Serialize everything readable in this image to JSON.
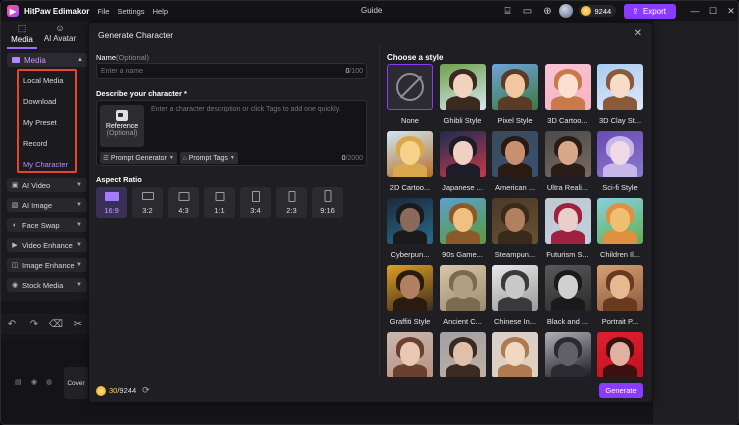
{
  "app": {
    "title": "HitPaw Edimakor",
    "menu": [
      "File",
      "Settings",
      "Help"
    ],
    "center_label": "Guide",
    "credits": "9244",
    "export_label": "Export"
  },
  "left_tabs": [
    {
      "label": "Media"
    },
    {
      "label": "AI Avatar"
    }
  ],
  "sidebar": {
    "media_label": "Media",
    "sub_items": [
      "Local Media",
      "Download",
      "My Preset",
      "Record",
      "My Character"
    ],
    "selected_sub": "My Character",
    "categories": [
      "AI Video",
      "AI Image",
      "Face Swap",
      "Video Enhance",
      "Image Enhance",
      "Stock Media"
    ],
    "cover_label": "Cover"
  },
  "modal": {
    "title": "Generate Character",
    "name_label": "Name",
    "name_optional": "(Optional)",
    "name_placeholder": "Enter a name",
    "name_count": "0",
    "name_max": "/100",
    "describe_label": "Describe your character *",
    "reference_label": "Reference",
    "reference_optional": "(Optional)",
    "describe_placeholder": "Enter a character description or click Tags to add one quickly.",
    "prompt_generator": "Prompt Generator",
    "prompt_tags": "Prompt Tags",
    "desc_count": "0",
    "desc_max": "/2000",
    "aspect_label": "Aspect Ratio",
    "ratios": [
      "16:9",
      "3:2",
      "4:3",
      "1:1",
      "3:4",
      "2:3",
      "9:16"
    ],
    "selected_ratio": "16:9",
    "cost_used": "30",
    "cost_total": "/9244",
    "generate_label": "Generate",
    "style_title": "Choose a style",
    "styles": [
      "None",
      "Ghibli Style",
      "Pixel Style",
      "3D Cartoo...",
      "3D Clay St...",
      "2D Cartoo...",
      "Japanese ...",
      "American ...",
      "Ultra Reali...",
      "Sci-fi Style",
      "Cyberpun...",
      "90s Game...",
      "Steampun...",
      "Futurism S...",
      "Children Il...",
      "Graffiti Style",
      "Ancient C...",
      "Chinese In...",
      "Black and ...",
      "Portrait P...",
      "",
      "",
      "",
      "",
      ""
    ],
    "selected_style": "None"
  },
  "colors": {
    "accent": "#8b3bff",
    "highlight_box": "#e8442e",
    "credit_used": "#ffd35a"
  }
}
